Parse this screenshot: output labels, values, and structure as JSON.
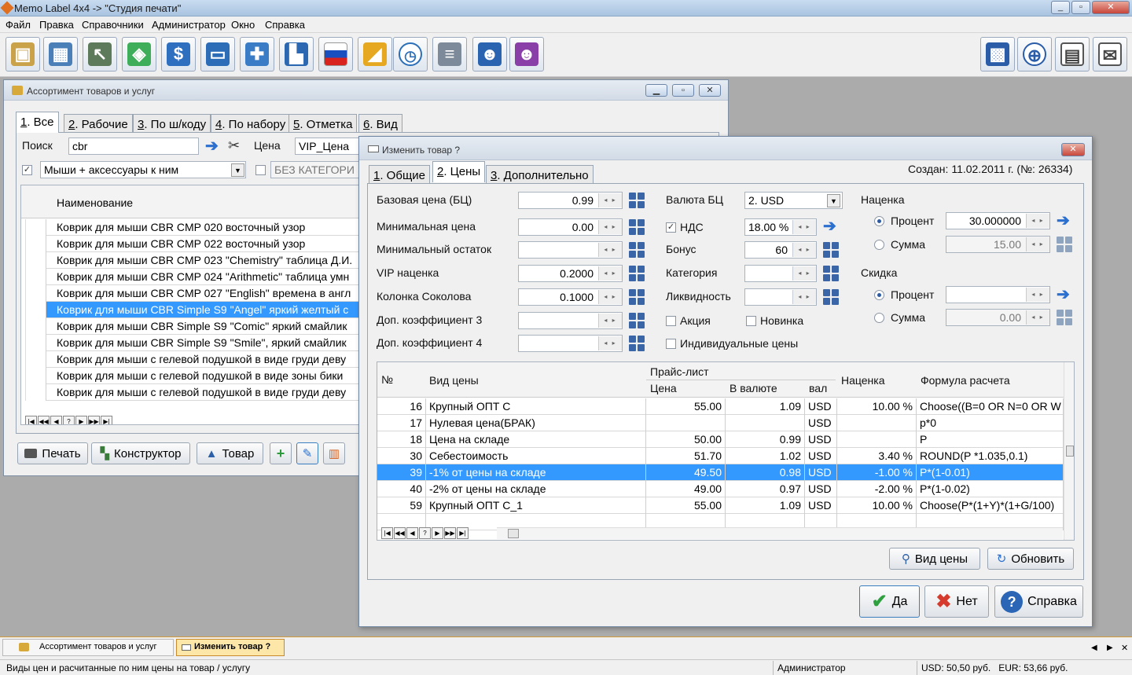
{
  "app": {
    "title": "Memo Label 4x4 -> \"Студия печати\""
  },
  "menu": [
    "Файл",
    "Правка",
    "Справочники",
    "Администратор",
    "Окно",
    "Справка"
  ],
  "toolbar": {
    "left_icons": [
      "box-icon",
      "picture-icon",
      "cursor-icon",
      "tag-icon",
      "dollar-icon",
      "tv-icon",
      "gift-icon",
      "factory-icon",
      "russia-flag-icon",
      "ruler-icon",
      "clock-icon",
      "server-icon",
      "man-icon",
      "woman-icon"
    ],
    "right_icons": [
      "chip-icon",
      "globe-icon",
      "message-icon",
      "mail-icon"
    ]
  },
  "assortment": {
    "title": "Ассортимент товаров и услуг",
    "tabs": [
      {
        "num": "1",
        "label": ". Все"
      },
      {
        "num": "2",
        "label": ". Рабочие"
      },
      {
        "num": "3",
        "label": ". По ш/коду"
      },
      {
        "num": "4",
        "label": ". По набору"
      },
      {
        "num": "5",
        "label": ". Отметка"
      },
      {
        "num": "6",
        "label": ". Вид"
      }
    ],
    "search_label": "Поиск",
    "search_value": "cbr",
    "price_label": "Цена",
    "price_value": "VIP_Цена",
    "category_value": "Мыши + аксессуары к ним",
    "nocat_value": "БЕЗ КАТЕГОРИ",
    "col_name": "Наименование",
    "rows": [
      "Коврик для мыши CBR CMP 020 восточный узор",
      "Коврик для мыши CBR CMP 022 восточный узор",
      "Коврик для мыши CBR CMP 023 \"Chemistry\" таблица Д.И.",
      "Коврик для мыши CBR CMP 024 \"Arithmetic\" таблица умн",
      "Коврик для мыши CBR CMP 027 \"English\" времена в англ",
      "Коврик для мыши CBR Simple S9 \"Angel\" яркий желтый с",
      "Коврик для мыши CBR Simple S9 \"Comic\" яркий смайлик",
      "Коврик для мыши CBR Simple S9 \"Smile\", яркий смайлик",
      "Коврик для мыши с гелевой подушкой в виде груди деву",
      "Коврик для мыши с гелевой подушкой в виде  зоны бики",
      "Коврик для мыши с гелевой подушкой в виде груди деву"
    ],
    "selected_row": 5,
    "buttons": {
      "print": "Печать",
      "constructor": "Конструктор",
      "product": "Товар"
    }
  },
  "dialog": {
    "title": "Изменить товар ?",
    "created": "Создан: 11.02.2011 г. (№: 26334)",
    "tabs": [
      {
        "num": "1",
        "label": ". Общие"
      },
      {
        "num": "2",
        "label": ". Цены"
      },
      {
        "num": "3",
        "label": ". Дополнительно"
      }
    ],
    "fields": {
      "base_price": {
        "label": "Базовая цена (БЦ)",
        "value": "0.99"
      },
      "min_price": {
        "label": "Минимальная цена",
        "value": "0.00"
      },
      "min_stock": {
        "label": "Минимальный остаток",
        "value": ""
      },
      "vip_markup": {
        "label": "VIP наценка",
        "value": "0.2000"
      },
      "sokolov": {
        "label": "Колонка Соколова",
        "value": "0.1000"
      },
      "coef3": {
        "label": "Доп. коэффициент 3",
        "value": ""
      },
      "coef4": {
        "label": "Доп. коэффициент 4",
        "value": ""
      },
      "currency": {
        "label": "Валюта БЦ",
        "value": "2. USD"
      },
      "vat": {
        "label": "НДС",
        "value": "18.00 %"
      },
      "bonus": {
        "label": "Бонус",
        "value": "60"
      },
      "category": {
        "label": "Категория",
        "value": ""
      },
      "liquidity": {
        "label": "Ликвидность",
        "value": ""
      },
      "promo": {
        "label": "Акция"
      },
      "novelty": {
        "label": "Новинка"
      },
      "individual": {
        "label": "Индивидуальные цены"
      }
    },
    "markup": {
      "title": "Наценка",
      "percent_label": "Процент",
      "percent_value": "30.000000",
      "sum_label": "Сумма",
      "sum_value": "15.00"
    },
    "discount": {
      "title": "Скидка",
      "percent_label": "Процент",
      "percent_value": "",
      "sum_label": "Сумма",
      "sum_value": "0.00"
    },
    "table": {
      "headers": {
        "no": "№",
        "type": "Вид цены",
        "pricelist": "Прайс-лист",
        "price": "Цена",
        "in_currency": "В валюте",
        "cur": "вал",
        "markup": "Наценка",
        "formula": "Формула расчета"
      },
      "rows": [
        {
          "no": "16",
          "type": "Крупный ОПТ С",
          "price": "55.00",
          "in_cur": "1.09",
          "cur": "USD",
          "markup": "10.00 %",
          "formula": "Choose((B=0 OR N=0 OR W"
        },
        {
          "no": "17",
          "type": "Нулевая цена(БРАК)",
          "price": "",
          "in_cur": "",
          "cur": "USD",
          "markup": "",
          "formula": "p*0"
        },
        {
          "no": "18",
          "type": "Цена на складе",
          "price": "50.00",
          "in_cur": "0.99",
          "cur": "USD",
          "markup": "",
          "formula": "P"
        },
        {
          "no": "30",
          "type": "Себестоимость",
          "price": "51.70",
          "in_cur": "1.02",
          "cur": "USD",
          "markup": "3.40 %",
          "formula": "ROUND(P *1.035,0.1)"
        },
        {
          "no": "39",
          "type": "-1% от цены на складе",
          "price": "49.50",
          "in_cur": "0.98",
          "cur": "USD",
          "markup": "-1.00 %",
          "formula": "P*(1-0.01)"
        },
        {
          "no": "40",
          "type": "-2% от цены на складе",
          "price": "49.00",
          "in_cur": "0.97",
          "cur": "USD",
          "markup": "-2.00 %",
          "formula": "P*(1-0.02)"
        },
        {
          "no": "59",
          "type": "Крупный ОПТ С_1",
          "price": "55.00",
          "in_cur": "1.09",
          "cur": "USD",
          "markup": "10.00 %",
          "formula": "Choose(P*(1+Y)*(1+G/100)"
        }
      ],
      "selected_row": 4
    },
    "buttons": {
      "price_type": "Вид цены",
      "refresh": "Обновить",
      "yes": "Да",
      "no": "Нет",
      "help": "Справка"
    }
  },
  "taskbar": {
    "item1": "Ассортимент товаров и услуг",
    "item2": "Изменить товар ?"
  },
  "status": {
    "hint": "Виды цен и расчитанные по ним цены на товар / услугу",
    "user": "Администратор",
    "rates": "USD: 50,50 руб.   EUR: 53,66 руб."
  }
}
